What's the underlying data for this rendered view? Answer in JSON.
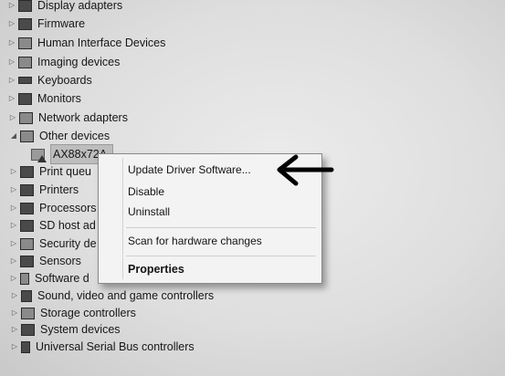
{
  "device_tree": {
    "items": [
      {
        "label": "Display adapters",
        "icon": "monitor-icon"
      },
      {
        "label": "Firmware",
        "icon": "chip-icon"
      },
      {
        "label": "Human Interface Devices",
        "icon": "hid-icon"
      },
      {
        "label": "Imaging devices",
        "icon": "camera-icon"
      },
      {
        "label": "Keyboards",
        "icon": "keyboard-icon"
      },
      {
        "label": "Monitors",
        "icon": "monitor-icon"
      },
      {
        "label": "Network adapters",
        "icon": "network-icon"
      },
      {
        "label": "Other devices",
        "icon": "question-device-icon"
      },
      {
        "label": "AX88x72A",
        "icon": "warning-device-icon",
        "selected": true
      },
      {
        "label": "Print queu",
        "icon": "printer-icon"
      },
      {
        "label": "Printers",
        "icon": "printer-icon"
      },
      {
        "label": "Processors",
        "icon": "cpu-icon"
      },
      {
        "label": "SD host ad",
        "icon": "sd-card-icon"
      },
      {
        "label": "Security de",
        "icon": "security-icon"
      },
      {
        "label": "Sensors",
        "icon": "sensor-icon"
      },
      {
        "label": "Software d",
        "icon": "software-icon"
      },
      {
        "label": "Sound, video and game controllers",
        "icon": "speaker-icon"
      },
      {
        "label": "Storage controllers",
        "icon": "storage-icon"
      },
      {
        "label": "System devices",
        "icon": "system-icon"
      },
      {
        "label": "Universal Serial Bus controllers",
        "icon": "usb-icon"
      }
    ]
  },
  "context_menu": {
    "update_driver": "Update Driver Software...",
    "disable": "Disable",
    "uninstall": "Uninstall",
    "scan": "Scan for hardware changes",
    "properties": "Properties"
  },
  "annotation": {
    "arrow_icon": "left-arrow-icon",
    "color": "#000000"
  }
}
